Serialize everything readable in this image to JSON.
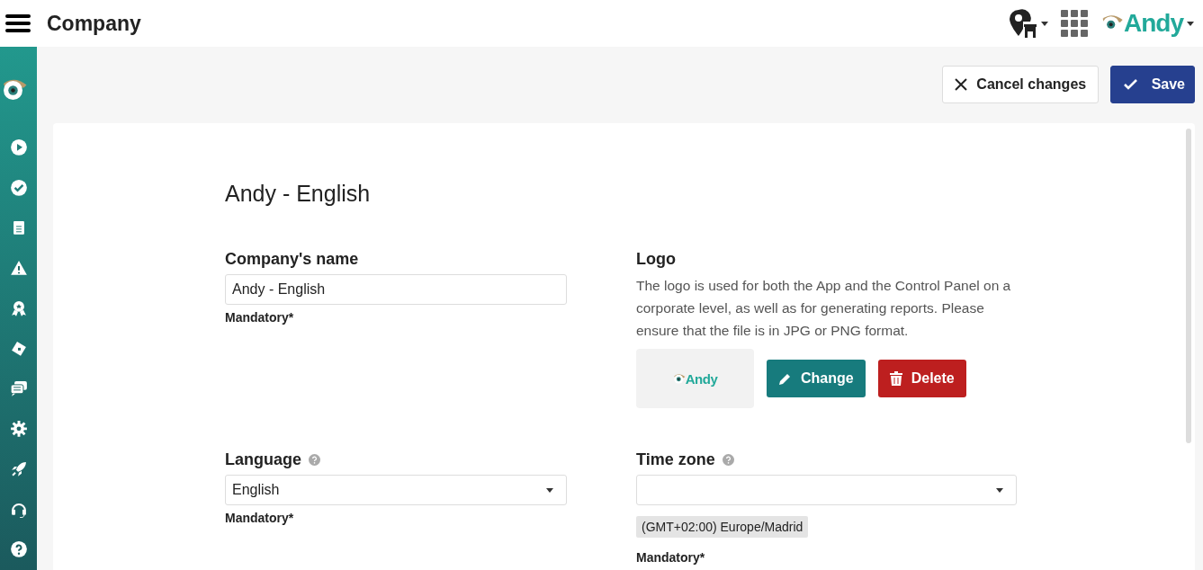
{
  "header": {
    "title": "Company",
    "brand": "Andy"
  },
  "toolbar": {
    "cancel": "Cancel changes",
    "save": "Save"
  },
  "form": {
    "heading": "Andy - English",
    "company_name": {
      "label": "Company's name",
      "value": "Andy - English",
      "note": "Mandatory*"
    },
    "logo": {
      "label": "Logo",
      "description": "The logo is used for both the App and the Control Panel on a corporate level, as well as for generating reports. Please ensure that the file is in JPG or PNG format.",
      "preview_text": "Andy",
      "change": "Change",
      "delete": "Delete"
    },
    "language": {
      "label": "Language",
      "value": "English",
      "note": "Mandatory*"
    },
    "time_zone": {
      "label": "Time zone",
      "tag": "(GMT+02:00) Europe/Madrid",
      "note": "Mandatory*"
    }
  }
}
